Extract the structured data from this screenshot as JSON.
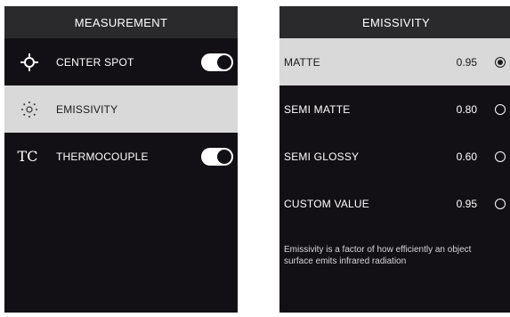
{
  "left_screen": {
    "title": "MEASUREMENT",
    "items": [
      {
        "label": "CENTER SPOT",
        "icon": "crosshair-icon",
        "toggle": true,
        "selected": false
      },
      {
        "label": "EMISSIVITY",
        "icon": "sun-dots-icon",
        "toggle": null,
        "selected": true
      },
      {
        "label": "THERMOCOUPLE",
        "icon_text": "TC",
        "toggle": true,
        "selected": false
      }
    ]
  },
  "right_screen": {
    "title": "EMISSIVITY",
    "options": [
      {
        "label": "MATTE",
        "value": "0.95",
        "selected": true
      },
      {
        "label": "SEMI MATTE",
        "value": "0.80",
        "selected": false
      },
      {
        "label": "SEMI GLOSSY",
        "value": "0.60",
        "selected": false
      },
      {
        "label": "CUSTOM VALUE",
        "value": "0.95",
        "selected": false
      }
    ],
    "description": "Emissivity is a factor of how efficiently an object surface emits infrared radiation"
  },
  "colors": {
    "screen_bg": "#121015",
    "header_bg": "#2a2a2c",
    "selected_bg": "#d9d9d9",
    "text": "#ffffff"
  }
}
